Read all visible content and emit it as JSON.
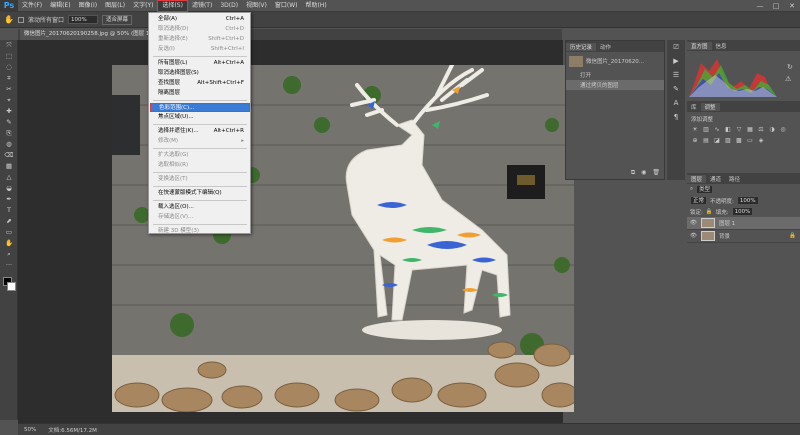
{
  "app": {
    "logo": "Ps"
  },
  "menubar": {
    "items": [
      "文件(F)",
      "编辑(E)",
      "图像(I)",
      "图层(L)",
      "文字(Y)",
      "选择(S)",
      "滤镜(T)",
      "3D(D)",
      "视图(V)",
      "窗口(W)",
      "帮助(H)"
    ],
    "active_index": 5
  },
  "window_controls": {
    "minimize": "—",
    "maximize": "□",
    "close": "✕"
  },
  "options": {
    "checkbox_label": "滚动所有窗口",
    "zoom_value": "100%",
    "fit_button": "适合屏幕"
  },
  "document": {
    "tab_title": "微信图片_20170620190258.jpg @ 50% (图层 1, RGB/8)",
    "close": "×"
  },
  "status": {
    "zoom": "50%",
    "doc_info": "文档:6.56M/17.2M"
  },
  "select_menu": {
    "items": [
      {
        "label": "全部(A)",
        "shortcut": "Ctrl+A",
        "disabled": false
      },
      {
        "label": "取消选择(D)",
        "shortcut": "Ctrl+D",
        "disabled": true
      },
      {
        "label": "重新选择(E)",
        "shortcut": "Shift+Ctrl+D",
        "disabled": true
      },
      {
        "label": "反选(I)",
        "shortcut": "Shift+Ctrl+I",
        "disabled": true
      },
      {
        "label": "所有图层(L)",
        "shortcut": "Alt+Ctrl+A",
        "disabled": false
      },
      {
        "label": "取消选择图层(S)",
        "shortcut": "",
        "disabled": false
      },
      {
        "label": "查找图层",
        "shortcut": "Alt+Shift+Ctrl+F",
        "disabled": false
      },
      {
        "label": "隔离图层",
        "shortcut": "",
        "disabled": false
      },
      {
        "label": "色彩范围(C)...",
        "shortcut": "",
        "disabled": false,
        "highlighted": true
      },
      {
        "label": "焦点区域(U)...",
        "shortcut": "",
        "disabled": false
      },
      {
        "label": "选择并遮住(K)...",
        "shortcut": "Alt+Ctrl+R",
        "disabled": false
      },
      {
        "label": "修改(M)",
        "shortcut": "▸",
        "disabled": true
      },
      {
        "label": "扩大选取(G)",
        "shortcut": "",
        "disabled": true
      },
      {
        "label": "选取相似(R)",
        "shortcut": "",
        "disabled": true
      },
      {
        "label": "变换选区(T)",
        "shortcut": "",
        "disabled": true
      },
      {
        "label": "在快速蒙版模式下编辑(Q)",
        "shortcut": "",
        "disabled": false
      },
      {
        "label": "载入选区(O)...",
        "shortcut": "",
        "disabled": false
      },
      {
        "label": "存储选区(V)...",
        "shortcut": "",
        "disabled": true
      },
      {
        "label": "新建 3D 模型(3)",
        "shortcut": "",
        "disabled": true
      }
    ]
  },
  "history_panel": {
    "tabs": [
      "历史记录",
      "动作"
    ],
    "snapshot": "微信图片_20170620...",
    "items": [
      "打开",
      "通过拷贝的图层"
    ]
  },
  "histogram_panel": {
    "tabs": [
      "直方图",
      "信息"
    ]
  },
  "adjust_panel": {
    "tabs": [
      "库",
      "调整"
    ],
    "add_label": "添加调整"
  },
  "layers_panel": {
    "tabs": [
      "图层",
      "通道",
      "路径"
    ],
    "filter_label": "类型",
    "blend_mode": "正常",
    "opacity_label": "不透明度:",
    "opacity": "100%",
    "lock_label": "锁定:",
    "fill_label": "填充:",
    "fill": "100%",
    "layers": [
      {
        "name": "图层 1",
        "selected": true
      },
      {
        "name": "背景",
        "selected": false
      }
    ]
  }
}
